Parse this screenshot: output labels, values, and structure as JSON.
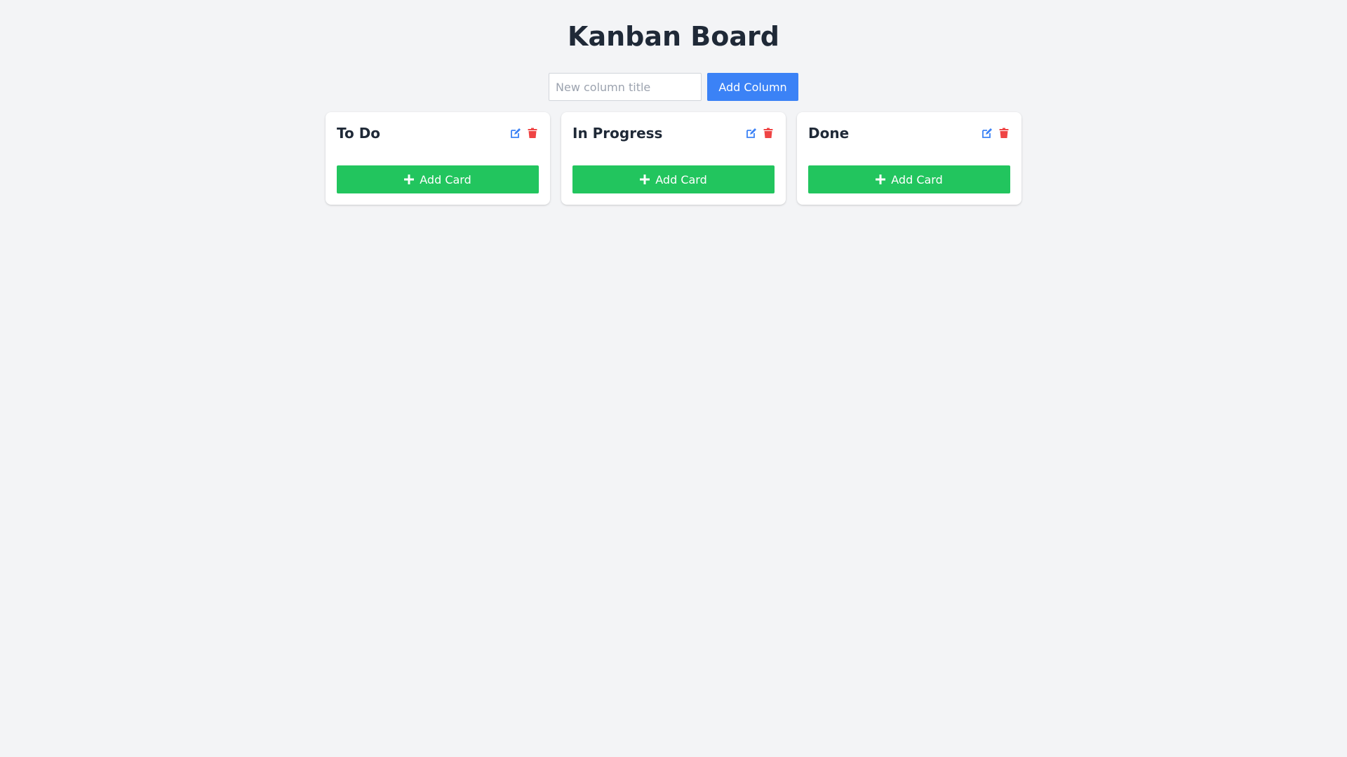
{
  "header": {
    "title": "Kanban Board"
  },
  "add_column": {
    "placeholder": "New column title",
    "value": "",
    "button_label": "Add Column"
  },
  "columns": [
    {
      "title": "To Do",
      "add_card_label": "Add Card"
    },
    {
      "title": "In Progress",
      "add_card_label": "Add Card"
    },
    {
      "title": "Done",
      "add_card_label": "Add Card"
    }
  ],
  "icons": {
    "edit": "edit-icon",
    "delete": "trash-icon",
    "add": "plus-icon"
  },
  "colors": {
    "background": "#f3f4f6",
    "primary": "#3b82f6",
    "success": "#22c55e",
    "danger": "#ef4444",
    "text": "#1f2937"
  }
}
